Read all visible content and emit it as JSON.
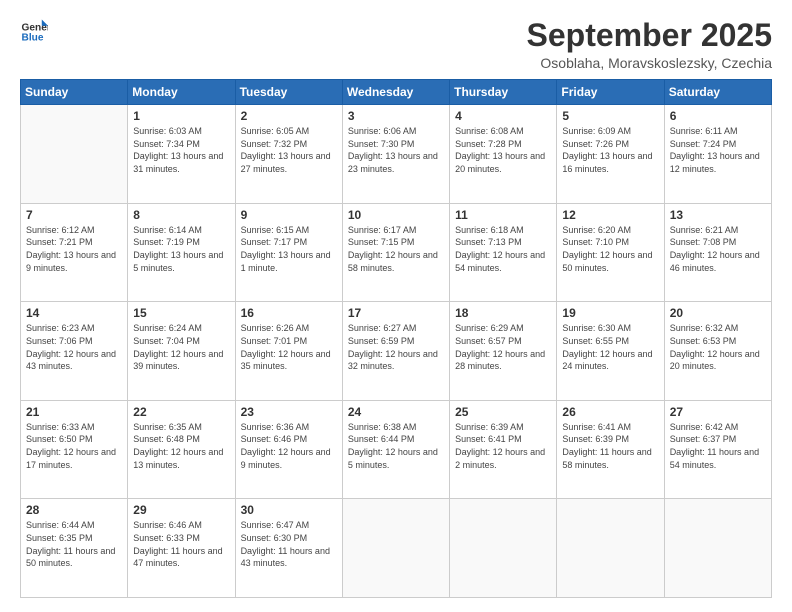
{
  "logo": {
    "line1": "General",
    "line2": "Blue"
  },
  "header": {
    "title": "September 2025",
    "location": "Osoblaha, Moravskoslezsky, Czechia"
  },
  "weekdays": [
    "Sunday",
    "Monday",
    "Tuesday",
    "Wednesday",
    "Thursday",
    "Friday",
    "Saturday"
  ],
  "weeks": [
    [
      {
        "day": "",
        "info": ""
      },
      {
        "day": "1",
        "info": "Sunrise: 6:03 AM\nSunset: 7:34 PM\nDaylight: 13 hours\nand 31 minutes."
      },
      {
        "day": "2",
        "info": "Sunrise: 6:05 AM\nSunset: 7:32 PM\nDaylight: 13 hours\nand 27 minutes."
      },
      {
        "day": "3",
        "info": "Sunrise: 6:06 AM\nSunset: 7:30 PM\nDaylight: 13 hours\nand 23 minutes."
      },
      {
        "day": "4",
        "info": "Sunrise: 6:08 AM\nSunset: 7:28 PM\nDaylight: 13 hours\nand 20 minutes."
      },
      {
        "day": "5",
        "info": "Sunrise: 6:09 AM\nSunset: 7:26 PM\nDaylight: 13 hours\nand 16 minutes."
      },
      {
        "day": "6",
        "info": "Sunrise: 6:11 AM\nSunset: 7:24 PM\nDaylight: 13 hours\nand 12 minutes."
      }
    ],
    [
      {
        "day": "7",
        "info": "Sunrise: 6:12 AM\nSunset: 7:21 PM\nDaylight: 13 hours\nand 9 minutes."
      },
      {
        "day": "8",
        "info": "Sunrise: 6:14 AM\nSunset: 7:19 PM\nDaylight: 13 hours\nand 5 minutes."
      },
      {
        "day": "9",
        "info": "Sunrise: 6:15 AM\nSunset: 7:17 PM\nDaylight: 13 hours\nand 1 minute."
      },
      {
        "day": "10",
        "info": "Sunrise: 6:17 AM\nSunset: 7:15 PM\nDaylight: 12 hours\nand 58 minutes."
      },
      {
        "day": "11",
        "info": "Sunrise: 6:18 AM\nSunset: 7:13 PM\nDaylight: 12 hours\nand 54 minutes."
      },
      {
        "day": "12",
        "info": "Sunrise: 6:20 AM\nSunset: 7:10 PM\nDaylight: 12 hours\nand 50 minutes."
      },
      {
        "day": "13",
        "info": "Sunrise: 6:21 AM\nSunset: 7:08 PM\nDaylight: 12 hours\nand 46 minutes."
      }
    ],
    [
      {
        "day": "14",
        "info": "Sunrise: 6:23 AM\nSunset: 7:06 PM\nDaylight: 12 hours\nand 43 minutes."
      },
      {
        "day": "15",
        "info": "Sunrise: 6:24 AM\nSunset: 7:04 PM\nDaylight: 12 hours\nand 39 minutes."
      },
      {
        "day": "16",
        "info": "Sunrise: 6:26 AM\nSunset: 7:01 PM\nDaylight: 12 hours\nand 35 minutes."
      },
      {
        "day": "17",
        "info": "Sunrise: 6:27 AM\nSunset: 6:59 PM\nDaylight: 12 hours\nand 32 minutes."
      },
      {
        "day": "18",
        "info": "Sunrise: 6:29 AM\nSunset: 6:57 PM\nDaylight: 12 hours\nand 28 minutes."
      },
      {
        "day": "19",
        "info": "Sunrise: 6:30 AM\nSunset: 6:55 PM\nDaylight: 12 hours\nand 24 minutes."
      },
      {
        "day": "20",
        "info": "Sunrise: 6:32 AM\nSunset: 6:53 PM\nDaylight: 12 hours\nand 20 minutes."
      }
    ],
    [
      {
        "day": "21",
        "info": "Sunrise: 6:33 AM\nSunset: 6:50 PM\nDaylight: 12 hours\nand 17 minutes."
      },
      {
        "day": "22",
        "info": "Sunrise: 6:35 AM\nSunset: 6:48 PM\nDaylight: 12 hours\nand 13 minutes."
      },
      {
        "day": "23",
        "info": "Sunrise: 6:36 AM\nSunset: 6:46 PM\nDaylight: 12 hours\nand 9 minutes."
      },
      {
        "day": "24",
        "info": "Sunrise: 6:38 AM\nSunset: 6:44 PM\nDaylight: 12 hours\nand 5 minutes."
      },
      {
        "day": "25",
        "info": "Sunrise: 6:39 AM\nSunset: 6:41 PM\nDaylight: 12 hours\nand 2 minutes."
      },
      {
        "day": "26",
        "info": "Sunrise: 6:41 AM\nSunset: 6:39 PM\nDaylight: 11 hours\nand 58 minutes."
      },
      {
        "day": "27",
        "info": "Sunrise: 6:42 AM\nSunset: 6:37 PM\nDaylight: 11 hours\nand 54 minutes."
      }
    ],
    [
      {
        "day": "28",
        "info": "Sunrise: 6:44 AM\nSunset: 6:35 PM\nDaylight: 11 hours\nand 50 minutes."
      },
      {
        "day": "29",
        "info": "Sunrise: 6:46 AM\nSunset: 6:33 PM\nDaylight: 11 hours\nand 47 minutes."
      },
      {
        "day": "30",
        "info": "Sunrise: 6:47 AM\nSunset: 6:30 PM\nDaylight: 11 hours\nand 43 minutes."
      },
      {
        "day": "",
        "info": ""
      },
      {
        "day": "",
        "info": ""
      },
      {
        "day": "",
        "info": ""
      },
      {
        "day": "",
        "info": ""
      }
    ]
  ]
}
